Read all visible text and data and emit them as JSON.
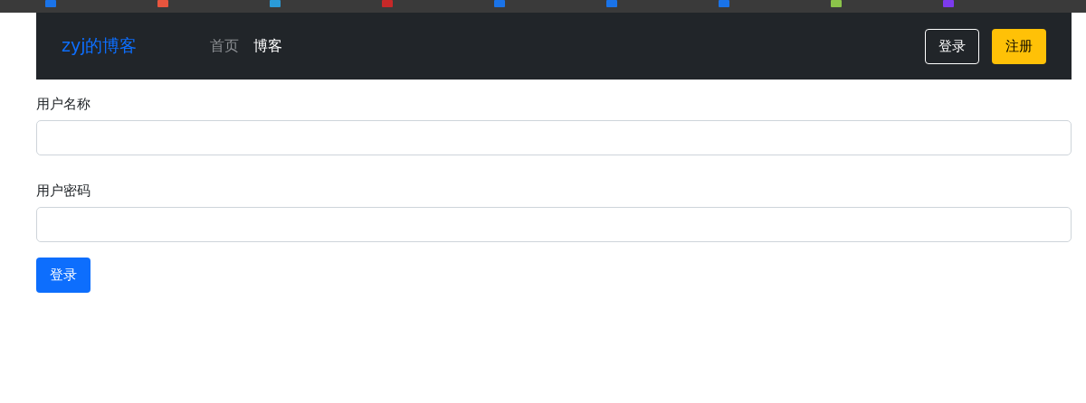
{
  "bookmarks_bar": {
    "icons": [
      {
        "color": "#1a73e8"
      },
      {
        "color": "#e8553e"
      },
      {
        "color": "#2a9bd8"
      },
      {
        "color": "#c62828"
      },
      {
        "color": "#1a73e8"
      },
      {
        "color": "#1a73e8"
      },
      {
        "color": "#1a73e8"
      },
      {
        "color": "#8bc34a"
      },
      {
        "color": "#7c3aed"
      }
    ]
  },
  "navbar": {
    "brand": "zyj的博客",
    "links": [
      {
        "label": "首页",
        "selected": false
      },
      {
        "label": "博客",
        "selected": true
      }
    ],
    "buttons": [
      {
        "label": "登录",
        "kind": "outline"
      },
      {
        "label": "注册",
        "kind": "warning"
      }
    ]
  },
  "form": {
    "fields": [
      {
        "label": "用户名称"
      },
      {
        "label": "用户密码"
      }
    ],
    "submit": "登录"
  }
}
